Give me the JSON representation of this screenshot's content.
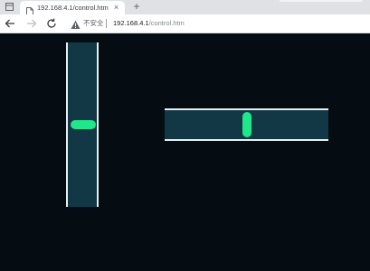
{
  "browser": {
    "tab": {
      "title": "192.168.4.1/control.htm",
      "close_symbol": "×"
    },
    "new_tab_symbol": "+",
    "address_bar": {
      "security_label": "不安全",
      "url_host": "192.168.4.1",
      "url_path": "/control.htm"
    },
    "icons": {
      "window_menu": "window-menu-icon",
      "favicon": "page-icon",
      "back": "arrow-left-icon",
      "forward": "arrow-right-icon",
      "reload": "reload-icon",
      "warning": "warning-triangle-icon"
    }
  },
  "controls": {
    "vertical_slider": {
      "position": 0.5
    },
    "horizontal_slider": {
      "position": 0.5
    }
  },
  "colors": {
    "page_background": "#050d12",
    "track_fill": "#133845",
    "track_border": "#e8eef0",
    "thumb": "#1ee88a"
  }
}
